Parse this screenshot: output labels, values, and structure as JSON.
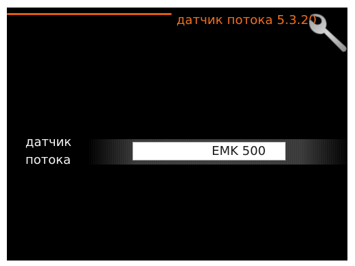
{
  "header": {
    "title": "датчик потока 5.3.20",
    "accent_color": "#e05a10",
    "icon": "wrench-icon"
  },
  "setting": {
    "label_line1": "датчик",
    "label_line2": "потока",
    "value": "EMK 500"
  }
}
